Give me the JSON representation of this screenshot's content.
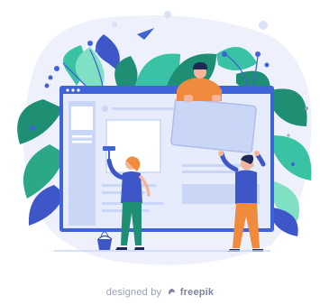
{
  "credit": {
    "prefix": "designed by",
    "brand": "freepik"
  },
  "colors": {
    "blob": "#eef1fb",
    "leaf_dark": "#1f8f73",
    "leaf_mid": "#39c3a4",
    "leaf_light": "#7fe0c4",
    "browser_frame": "#3f63d8",
    "browser_content": "#e6ecfb",
    "panel": "#c9d6f6",
    "accent_orange": "#f08a3c",
    "person_blue": "#3e57c8"
  }
}
